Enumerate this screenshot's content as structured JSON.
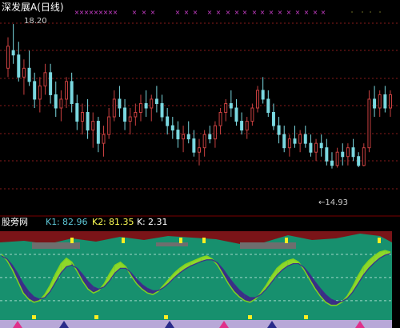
{
  "chart_data": [
    {
      "type": "candlestick",
      "title": "深发展A(日线)",
      "ylim": [
        14.0,
        18.6
      ],
      "annotations": {
        "high_label": "18.20",
        "low_label": "←14.93"
      },
      "bars": [
        [
          17.2,
          17.9,
          17.0,
          17.7
        ],
        [
          17.6,
          18.2,
          17.3,
          17.5
        ],
        [
          17.5,
          17.8,
          16.9,
          17.0
        ],
        [
          17.0,
          17.4,
          16.6,
          17.2
        ],
        [
          17.2,
          17.6,
          16.8,
          16.9
        ],
        [
          16.9,
          17.1,
          16.3,
          16.5
        ],
        [
          16.5,
          17.0,
          16.2,
          16.8
        ],
        [
          16.8,
          17.3,
          16.6,
          17.1
        ],
        [
          17.1,
          17.3,
          16.4,
          16.6
        ],
        [
          16.6,
          16.9,
          16.1,
          16.3
        ],
        [
          16.3,
          16.7,
          16.0,
          16.5
        ],
        [
          16.5,
          17.0,
          16.3,
          16.9
        ],
        [
          16.9,
          17.1,
          16.2,
          16.4
        ],
        [
          16.4,
          16.6,
          15.8,
          16.0
        ],
        [
          16.0,
          16.4,
          15.7,
          16.2
        ],
        [
          16.2,
          16.5,
          15.6,
          15.8
        ],
        [
          15.8,
          16.2,
          15.4,
          16.0
        ],
        [
          16.0,
          16.1,
          15.3,
          15.5
        ],
        [
          15.5,
          15.9,
          15.2,
          15.7
        ],
        [
          15.7,
          16.3,
          15.6,
          16.1
        ],
        [
          16.1,
          16.7,
          16.0,
          16.5
        ],
        [
          16.5,
          16.8,
          16.1,
          16.3
        ],
        [
          16.3,
          16.5,
          15.8,
          16.0
        ],
        [
          16.0,
          16.3,
          15.7,
          16.1
        ],
        [
          16.1,
          16.4,
          15.9,
          16.2
        ],
        [
          16.2,
          16.6,
          16.0,
          16.4
        ],
        [
          16.4,
          16.7,
          16.1,
          16.3
        ],
        [
          16.3,
          16.6,
          16.0,
          16.5
        ],
        [
          16.5,
          16.8,
          16.2,
          16.4
        ],
        [
          16.4,
          16.6,
          16.0,
          16.1
        ],
        [
          16.1,
          16.3,
          15.7,
          15.9
        ],
        [
          15.9,
          16.1,
          15.6,
          15.8
        ],
        [
          15.8,
          16.0,
          15.4,
          15.6
        ],
        [
          15.6,
          15.9,
          15.3,
          15.7
        ],
        [
          15.7,
          16.0,
          15.5,
          15.6
        ],
        [
          15.6,
          15.8,
          15.2,
          15.3
        ],
        [
          15.3,
          15.6,
          15.0,
          15.4
        ],
        [
          15.4,
          15.8,
          15.2,
          15.7
        ],
        [
          15.7,
          15.9,
          15.5,
          15.6
        ],
        [
          15.6,
          16.0,
          15.4,
          15.9
        ],
        [
          15.9,
          16.3,
          15.7,
          16.2
        ],
        [
          16.2,
          16.5,
          16.0,
          16.4
        ],
        [
          16.4,
          16.7,
          16.1,
          16.3
        ],
        [
          16.3,
          16.5,
          15.9,
          16.0
        ],
        [
          16.0,
          16.2,
          15.7,
          15.8
        ],
        [
          15.8,
          16.1,
          15.6,
          16.0
        ],
        [
          16.0,
          16.4,
          15.9,
          16.3
        ],
        [
          16.3,
          16.8,
          16.2,
          16.7
        ],
        [
          16.7,
          17.0,
          16.4,
          16.5
        ],
        [
          16.5,
          16.7,
          16.1,
          16.2
        ],
        [
          16.2,
          16.4,
          15.8,
          15.9
        ],
        [
          15.9,
          16.1,
          15.5,
          15.7
        ],
        [
          15.7,
          15.9,
          15.3,
          15.4
        ],
        [
          15.4,
          15.7,
          15.2,
          15.6
        ],
        [
          15.6,
          15.9,
          15.4,
          15.5
        ],
        [
          15.5,
          15.8,
          15.3,
          15.7
        ],
        [
          15.7,
          15.9,
          15.4,
          15.5
        ],
        [
          15.5,
          15.7,
          15.2,
          15.3
        ],
        [
          15.3,
          15.6,
          15.1,
          15.5
        ],
        [
          15.5,
          15.7,
          15.2,
          15.4
        ],
        [
          15.4,
          15.6,
          15.0,
          15.1
        ],
        [
          15.1,
          15.3,
          14.93,
          15.0
        ],
        [
          15.0,
          15.4,
          14.95,
          15.3
        ],
        [
          15.3,
          15.5,
          15.0,
          15.2
        ],
        [
          15.2,
          15.5,
          15.0,
          15.4
        ],
        [
          15.4,
          15.6,
          15.1,
          15.2
        ],
        [
          15.2,
          15.3,
          14.96,
          15.0
        ],
        [
          15.0,
          15.5,
          14.98,
          15.4
        ],
        [
          15.4,
          16.7,
          15.3,
          16.5
        ],
        [
          16.5,
          16.8,
          16.1,
          16.3
        ],
        [
          16.3,
          16.7,
          16.1,
          16.6
        ],
        [
          16.6,
          16.8,
          16.2,
          16.3
        ],
        [
          16.3,
          16.7,
          16.1,
          16.6
        ]
      ]
    },
    {
      "type": "line",
      "title": "股旁网",
      "ylim": [
        -5,
        110
      ],
      "series": [
        {
          "name": "K1",
          "legend_value": "82.96",
          "color": "#7fd320",
          "values": [
            80,
            72,
            60,
            45,
            30,
            22,
            18,
            20,
            28,
            40,
            55,
            68,
            75,
            70,
            58,
            45,
            35,
            30,
            33,
            42,
            55,
            66,
            70,
            64,
            52,
            42,
            35,
            30,
            28,
            32,
            40,
            48,
            56,
            62,
            67,
            70,
            73,
            76,
            78,
            74,
            66,
            54,
            42,
            32,
            25,
            20,
            18,
            22,
            30,
            40,
            52,
            62,
            68,
            72,
            74,
            70,
            60,
            48,
            36,
            26,
            18,
            14,
            14,
            18,
            26,
            38,
            52,
            64,
            72,
            78,
            83,
            85,
            83
          ]
        },
        {
          "name": "K2",
          "legend_value": "81.35",
          "color": "#3c2e8c",
          "values": [
            78,
            74,
            66,
            55,
            42,
            32,
            25,
            22,
            24,
            32,
            44,
            56,
            64,
            66,
            62,
            54,
            45,
            38,
            35,
            38,
            46,
            56,
            62,
            62,
            56,
            48,
            41,
            36,
            33,
            33,
            37,
            43,
            50,
            56,
            61,
            65,
            68,
            71,
            73,
            73,
            69,
            61,
            51,
            42,
            34,
            28,
            24,
            24,
            28,
            35,
            44,
            53,
            60,
            65,
            68,
            68,
            63,
            55,
            45,
            36,
            28,
            22,
            19,
            19,
            23,
            31,
            42,
            53,
            62,
            69,
            75,
            79,
            81
          ]
        },
        {
          "name": "K",
          "legend_value": "2.31"
        }
      ],
      "guides": [
        80,
        50,
        20
      ]
    }
  ]
}
